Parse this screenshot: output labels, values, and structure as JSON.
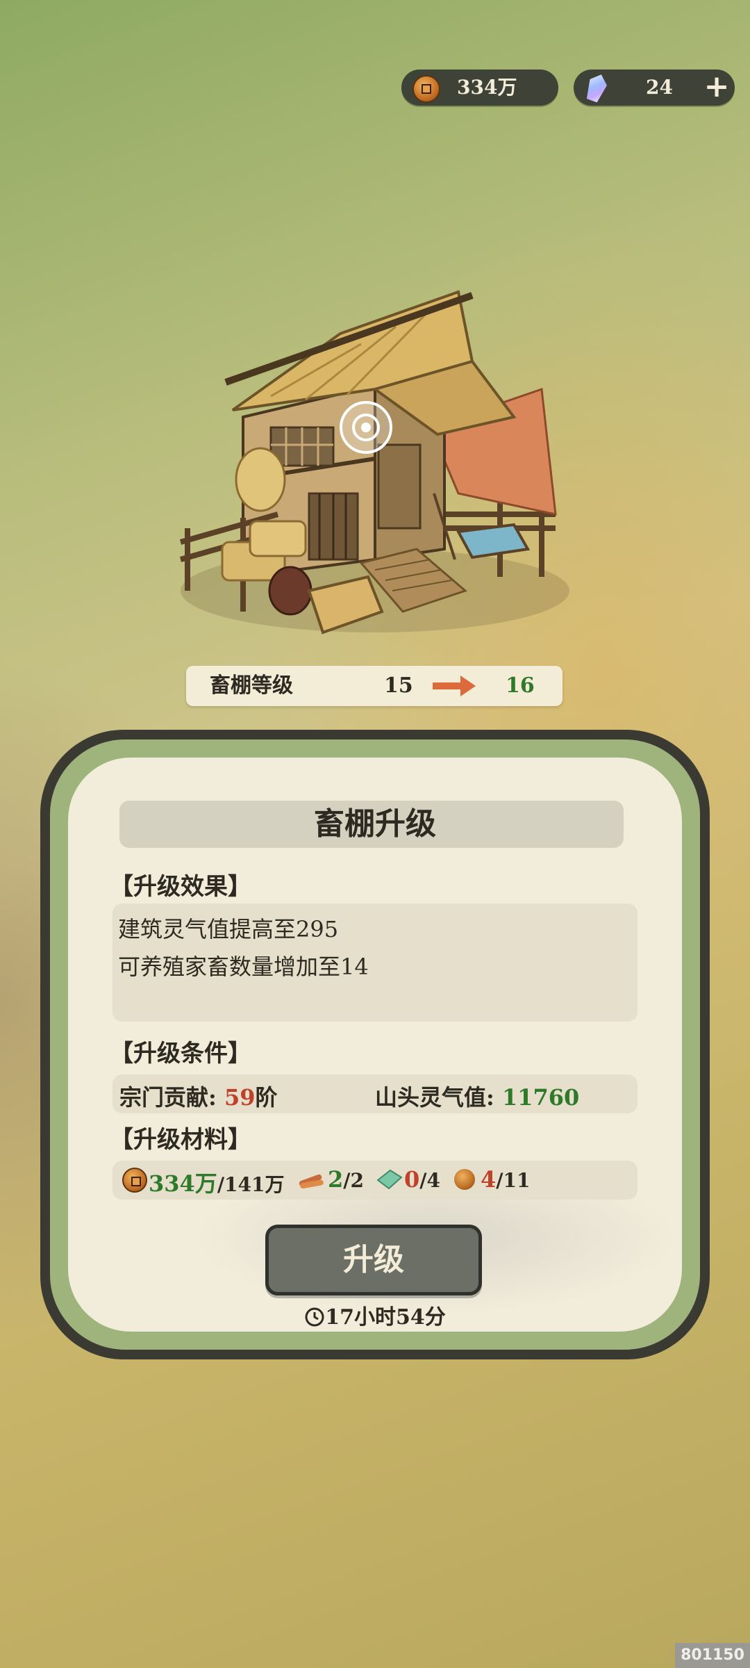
{
  "currency": {
    "coins": "334万",
    "gems": "24",
    "coin_icon": "copper-coin-icon",
    "gem_icon": "spirit-crystal-icon",
    "add_icon": "plus-icon"
  },
  "building": {
    "name_level_label": "畜棚等级",
    "current_level": "15",
    "next_level": "16",
    "arrow_icon": "arrow-right-icon"
  },
  "panel": {
    "title": "畜棚升级",
    "effects_header": "【升级效果】",
    "effects": [
      "建筑灵气值提高至295",
      "可养殖家畜数量增加至14"
    ],
    "conditions_header": "【升级条件】",
    "conditions": {
      "sect_label": "宗门贡献:",
      "sect_value": "59",
      "sect_unit": "阶",
      "aura_label": "山头灵气值:",
      "aura_value": "11760"
    },
    "materials_header": "【升级材料】",
    "materials": {
      "coins_have": "334万",
      "coins_need": "/141万",
      "wood_have": "2",
      "wood_need": "/2",
      "jade_have": "0",
      "jade_need": "/4",
      "copper_have": "4",
      "copper_need": "/11"
    },
    "upgrade_button": "升级",
    "timer": "17小时54分"
  },
  "colors": {
    "ok": "#2f7a2a",
    "insufficient": "#c0412a",
    "button": "#6c6f66"
  },
  "watermark": "801150"
}
